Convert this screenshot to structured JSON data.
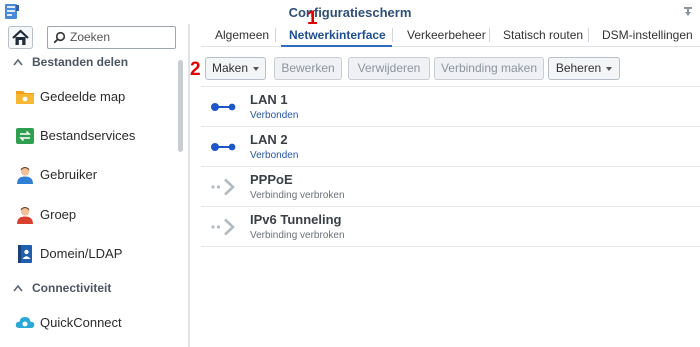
{
  "window": {
    "title": "Configuratiescherm"
  },
  "sidebar": {
    "search_placeholder": "Zoeken",
    "sections": [
      {
        "label": "Bestanden delen",
        "icon": "chevron-up-icon"
      },
      {
        "label": "Connectiviteit",
        "icon": "chevron-up-icon"
      }
    ],
    "items": [
      {
        "label": "Gedeelde map",
        "icon": "shared-folder-icon"
      },
      {
        "label": "Bestandservices",
        "icon": "file-services-icon"
      },
      {
        "label": "Gebruiker",
        "icon": "user-icon"
      },
      {
        "label": "Groep",
        "icon": "group-icon"
      },
      {
        "label": "Domein/LDAP",
        "icon": "domain-ldap-icon"
      },
      {
        "label": "QuickConnect",
        "icon": "quickconnect-icon"
      }
    ]
  },
  "tabs": [
    {
      "label": "Algemeen",
      "active": false
    },
    {
      "label": "Netwerkinterface",
      "active": true
    },
    {
      "label": "Verkeerbeheer",
      "active": false
    },
    {
      "label": "Statisch routen",
      "active": false
    },
    {
      "label": "DSM-instellingen",
      "active": false
    }
  ],
  "markers": [
    "1",
    "2"
  ],
  "toolbar": {
    "create": "Maken",
    "edit": "Bewerken",
    "delete": "Verwijderen",
    "connect": "Verbinding maken",
    "manage": "Beheren"
  },
  "interfaces": [
    {
      "name": "LAN 1",
      "status": "Verbonden",
      "state": "connected"
    },
    {
      "name": "LAN 2",
      "status": "Verbonden",
      "state": "connected"
    },
    {
      "name": "PPPoE",
      "status": "Verbinding verbroken",
      "state": "disconnected"
    },
    {
      "name": "IPv6 Tunneling",
      "status": "Verbinding verbroken",
      "state": "disconnected"
    }
  ],
  "colors": {
    "accent": "#2e6dbf",
    "title": "#2f4f79",
    "marker": "#e00000",
    "connected": "#1d56c9"
  }
}
